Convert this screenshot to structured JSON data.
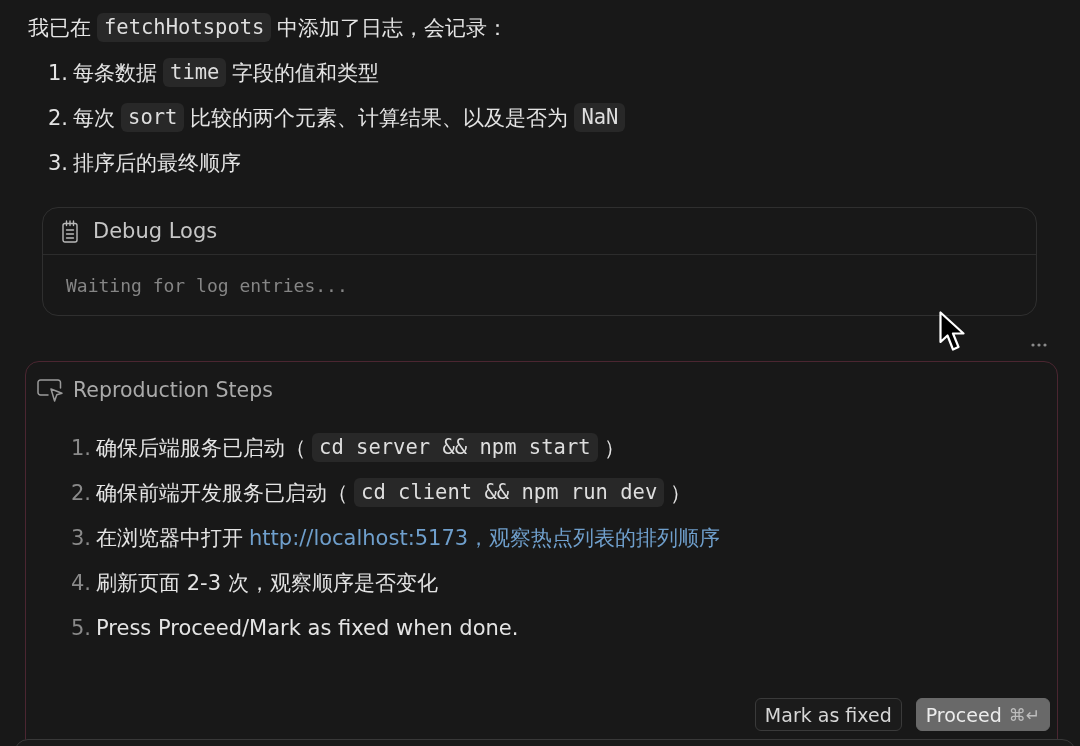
{
  "intro": [
    {
      "kind": "text",
      "text": "我已在"
    },
    {
      "kind": "code",
      "text": "fetchHotspots"
    },
    {
      "kind": "text",
      "text": "中添加了日志，会记录："
    }
  ],
  "log_items": [
    {
      "number": "1.",
      "parts": [
        {
          "kind": "text",
          "text": "每条数据"
        },
        {
          "kind": "code",
          "text": "time"
        },
        {
          "kind": "text",
          "text": "字段的值和类型"
        }
      ]
    },
    {
      "number": "2.",
      "parts": [
        {
          "kind": "text",
          "text": "每次"
        },
        {
          "kind": "code",
          "text": "sort"
        },
        {
          "kind": "text",
          "text": "比较的两个元素、计算结果、以及是否为"
        },
        {
          "kind": "code",
          "text": "NaN"
        }
      ]
    },
    {
      "number": "3.",
      "parts": [
        {
          "kind": "text",
          "text": "排序后的最终顺序"
        }
      ]
    }
  ],
  "debug_logs": {
    "title": "Debug Logs",
    "empty_message": "Waiting for log entries..."
  },
  "reproduction_steps": {
    "title": "Reproduction Steps",
    "steps": [
      {
        "number": "1.",
        "parts": [
          {
            "kind": "text",
            "text": "确保后端服务已启动（"
          },
          {
            "kind": "code",
            "text": "cd server && npm start"
          },
          {
            "kind": "text",
            "text": "）"
          }
        ]
      },
      {
        "number": "2.",
        "parts": [
          {
            "kind": "text",
            "text": "确保前端开发服务已启动（"
          },
          {
            "kind": "code",
            "text": "cd client && npm run dev"
          },
          {
            "kind": "text",
            "text": "）"
          }
        ]
      },
      {
        "number": "3.",
        "parts": [
          {
            "kind": "text",
            "text": "在浏览器中打开"
          },
          {
            "kind": "link",
            "text": "http://localhost:5173，观察热点列表的排列顺序"
          }
        ]
      },
      {
        "number": "4.",
        "parts": [
          {
            "kind": "text",
            "text": "刷新页面 2-3 次，观察顺序是否变化"
          }
        ]
      },
      {
        "number": "5.",
        "parts": [
          {
            "kind": "text",
            "text": "Press Proceed/Mark as fixed when done."
          }
        ]
      }
    ],
    "buttons": [
      {
        "kind": "secondary",
        "label": "Mark as fixed"
      },
      {
        "kind": "primary",
        "label": "Proceed",
        "shortcut": "⌘↵"
      }
    ]
  }
}
